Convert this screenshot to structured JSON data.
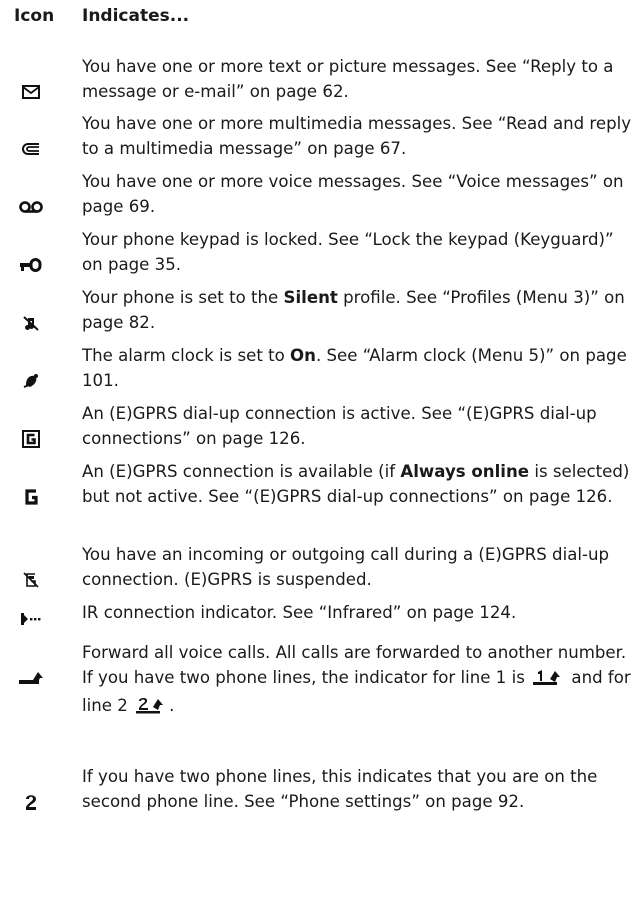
{
  "header": {
    "icon_col": "Icon",
    "indicates_col": "Indicates..."
  },
  "rows": [
    {
      "icon": "envelope-icon",
      "desc": [
        "You have one or more text or picture messages. See “Reply to a message or e-mail” on page 62."
      ]
    },
    {
      "icon": "multimedia-message-icon",
      "desc": [
        "You have one or more multimedia messages. See “Read and reply to a multimedia message” on page 67."
      ]
    },
    {
      "icon": "voicemail-icon",
      "desc": [
        "You have one or more voice messages. See “Voice messages” on page 69."
      ]
    },
    {
      "icon": "key-lock-icon",
      "desc": [
        "Your phone keypad is locked. See “Lock the keypad (Keyguard)” on page 35."
      ]
    },
    {
      "icon": "silent-profile-icon",
      "desc": [
        "Your phone is set to the ",
        "Silent",
        " profile. See “Profiles (Menu 3)” on page 82."
      ]
    },
    {
      "icon": "alarm-clock-icon",
      "desc": [
        "The alarm clock is set to ",
        "On",
        ". See “Alarm clock (Menu 5)” on page 101."
      ]
    },
    {
      "icon": "gprs-active-icon",
      "desc": [
        "An (E)GPRS dial-up connection is active. See “(E)GPRS dial-up connections” on page 126."
      ]
    },
    {
      "icon": "gprs-available-icon",
      "desc": [
        "An (E)GPRS connection is available (if ",
        "Always online",
        " is selected) but not active. See “(E)GPRS dial-up connections” on page 126."
      ]
    },
    {
      "icon": "gprs-suspended-icon",
      "desc": [
        "You have an incoming or outgoing call during a (E)GPRS dial-up connection. (E)GPRS is suspended."
      ]
    },
    {
      "icon": "infrared-icon",
      "desc": [
        " IR connection indicator. See “Infrared” on page 124."
      ]
    },
    {
      "icon": "call-forward-icon",
      "desc": [
        "Forward all voice calls. All calls are forwarded to another number. If you have two phone lines, the indicator for line 1 is ",
        " and for line 2 ",
        "."
      ]
    },
    {
      "icon": "line-2-icon",
      "desc": [
        "If you have two phone lines, this indicates that you are on the second phone line. See “Phone settings” on page 92."
      ]
    }
  ]
}
